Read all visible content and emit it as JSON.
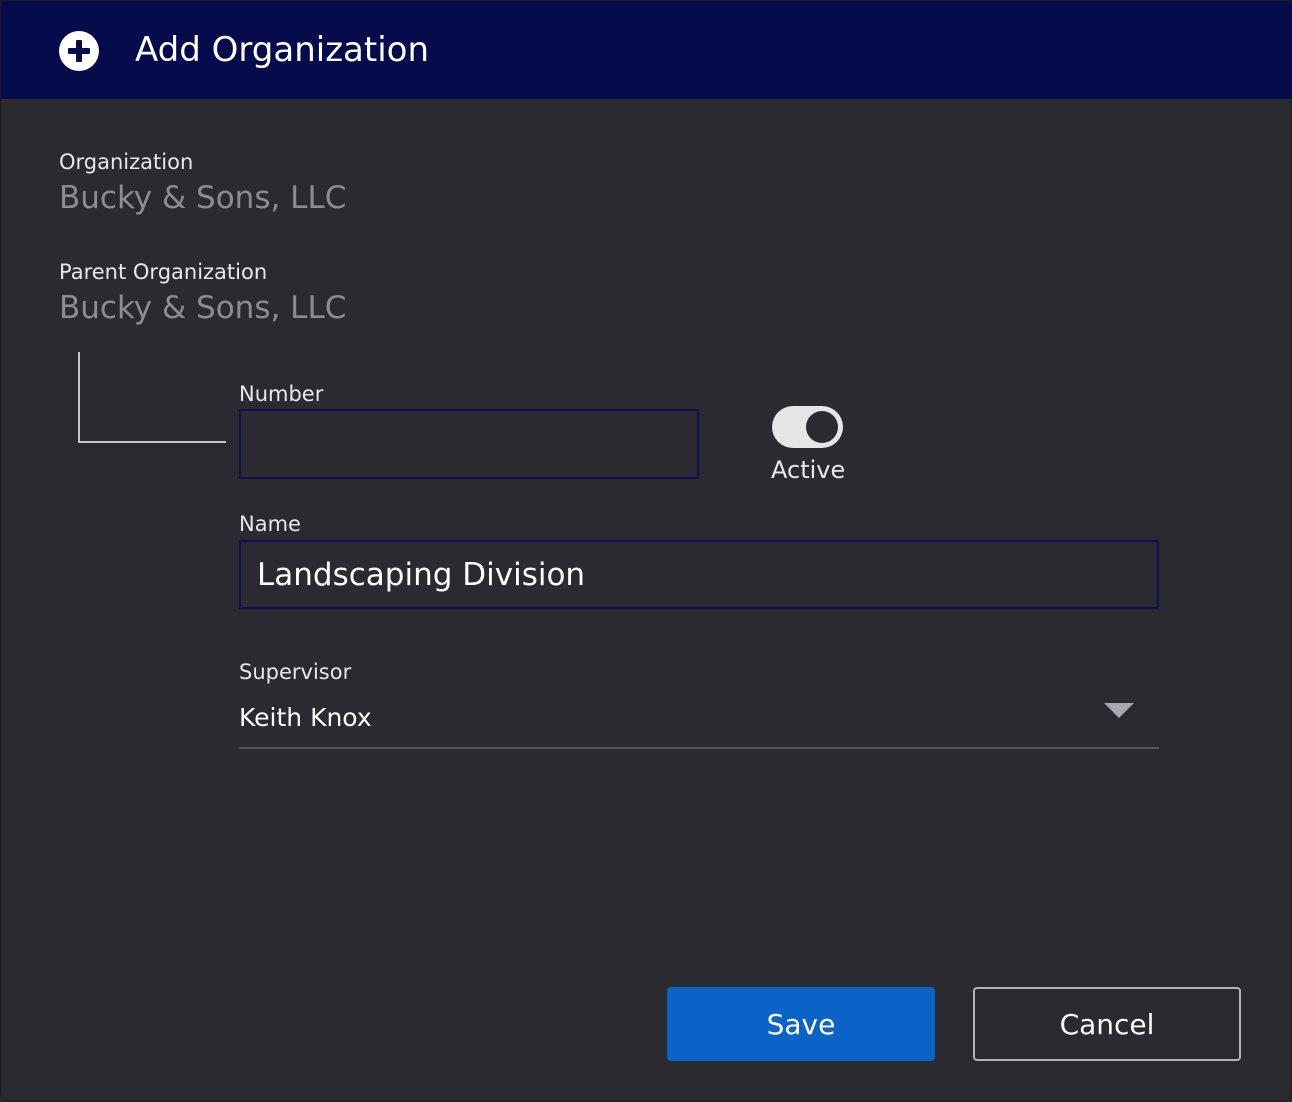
{
  "dialog": {
    "title": "Add Organization",
    "icon": "plus-circle-icon"
  },
  "fields": {
    "organization_label": "Organization",
    "organization_value": "Bucky & Sons, LLC",
    "parent_label": "Parent Organization",
    "parent_value": "Bucky & Sons, LLC",
    "number_label": "Number",
    "number_value": "",
    "active_label": "Active",
    "active_on": true,
    "name_label": "Name",
    "name_value": "Landscaping Division",
    "supervisor_label": "Supervisor",
    "supervisor_value": "Keith Knox"
  },
  "actions": {
    "save_label": "Save",
    "cancel_label": "Cancel"
  },
  "colors": {
    "header_bg": "#060b4c",
    "body_bg": "#2a2a30",
    "primary": "#0a64c8",
    "field_border": "#0b0f5c"
  }
}
